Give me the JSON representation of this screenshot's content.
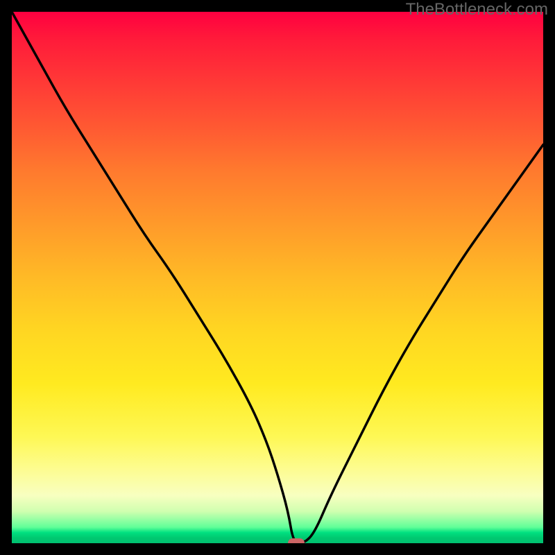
{
  "attribution": "TheBottleneck.com",
  "chart_data": {
    "type": "line",
    "title": "",
    "xlabel": "",
    "ylabel": "",
    "x": [
      0,
      5,
      10,
      15,
      20,
      25,
      30,
      35,
      40,
      45,
      48,
      50,
      52,
      53,
      55,
      57,
      60,
      65,
      70,
      75,
      80,
      85,
      90,
      95,
      100
    ],
    "values": [
      100,
      91,
      82,
      74,
      66,
      58,
      51,
      43,
      35,
      26,
      19,
      13,
      6,
      0,
      0,
      2,
      9,
      19,
      29,
      38,
      46,
      54,
      61,
      68,
      75
    ],
    "ylim": [
      0,
      100
    ],
    "xlim": [
      0,
      100
    ],
    "marker_x": 53.5,
    "marker_y": 0,
    "gradient_stops": [
      {
        "pos": 0,
        "color": "#ff0040"
      },
      {
        "pos": 50,
        "color": "#ffd020"
      },
      {
        "pos": 85,
        "color": "#fefc80"
      },
      {
        "pos": 100,
        "color": "#00c070"
      }
    ]
  }
}
